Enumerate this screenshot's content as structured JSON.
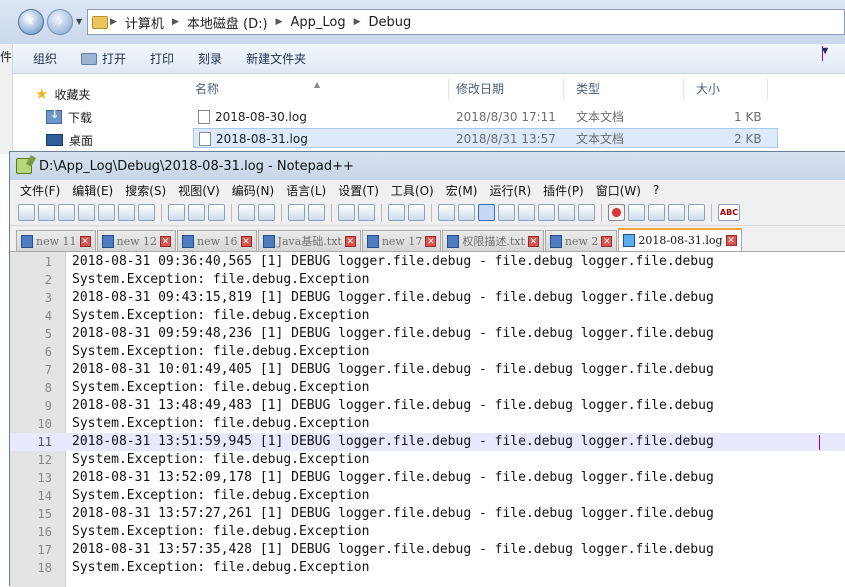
{
  "explorer": {
    "breadcrumb": [
      "计算机",
      "本地磁盘 (D:)",
      "App_Log",
      "Debug"
    ],
    "toolbar": {
      "organize": "组织",
      "open": "打开",
      "print": "打印",
      "burn": "刻录",
      "new_folder": "新建文件夹"
    },
    "left_edge_char": "件",
    "nav": {
      "favorites": "收藏夹",
      "downloads": "下载",
      "desktop": "桌面"
    },
    "columns": {
      "name": "名称",
      "date": "修改日期",
      "type": "类型",
      "size": "大小"
    },
    "files": [
      {
        "name": "2018-08-30.log",
        "date": "2018/8/30 17:11",
        "type": "文本文档",
        "size": "1 KB"
      },
      {
        "name": "2018-08-31.log",
        "date": "2018/8/31 13:57",
        "type": "文本文档",
        "size": "2 KB"
      }
    ]
  },
  "npp": {
    "title": "D:\\App_Log\\Debug\\2018-08-31.log - Notepad++",
    "menu": [
      "文件(F)",
      "编辑(E)",
      "搜索(S)",
      "视图(V)",
      "编码(N)",
      "语言(L)",
      "设置(T)",
      "工具(O)",
      "宏(M)",
      "运行(R)",
      "插件(P)",
      "窗口(W)",
      "?"
    ],
    "tabs": [
      {
        "label": "new 11",
        "active": false
      },
      {
        "label": "new 12",
        "active": false
      },
      {
        "label": "new 16",
        "active": false
      },
      {
        "label": "Java基础.txt",
        "active": false
      },
      {
        "label": "new 17",
        "active": false
      },
      {
        "label": "权限描述.txt",
        "active": false
      },
      {
        "label": "new 2",
        "active": false
      },
      {
        "label": "2018-08-31.log",
        "active": true
      }
    ],
    "current_line": 11,
    "lines": [
      {
        "n": "1",
        "text": "2018-08-31 09:36:40,565 [1] DEBUG logger.file.debug - file.debug logger.file.debug"
      },
      {
        "n": "2",
        "text": "System.Exception: file.debug.Exception"
      },
      {
        "n": "3",
        "text": "2018-08-31 09:43:15,819 [1] DEBUG logger.file.debug - file.debug logger.file.debug"
      },
      {
        "n": "4",
        "text": "System.Exception: file.debug.Exception"
      },
      {
        "n": "5",
        "text": "2018-08-31 09:59:48,236 [1] DEBUG logger.file.debug - file.debug logger.file.debug"
      },
      {
        "n": "6",
        "text": "System.Exception: file.debug.Exception"
      },
      {
        "n": "7",
        "text": "2018-08-31 10:01:49,405 [1] DEBUG logger.file.debug - file.debug logger.file.debug"
      },
      {
        "n": "8",
        "text": "System.Exception: file.debug.Exception"
      },
      {
        "n": "9",
        "text": "2018-08-31 13:48:49,483 [1] DEBUG logger.file.debug - file.debug logger.file.debug"
      },
      {
        "n": "10",
        "text": "System.Exception: file.debug.Exception"
      },
      {
        "n": "11",
        "text": "2018-08-31 13:51:59,945 [1] DEBUG logger.file.debug - file.debug logger.file.debug"
      },
      {
        "n": "12",
        "text": "System.Exception: file.debug.Exception"
      },
      {
        "n": "13",
        "text": "2018-08-31 13:52:09,178 [1] DEBUG logger.file.debug - file.debug logger.file.debug"
      },
      {
        "n": "14",
        "text": "System.Exception: file.debug.Exception"
      },
      {
        "n": "15",
        "text": "2018-08-31 13:57:27,261 [1] DEBUG logger.file.debug - file.debug logger.file.debug"
      },
      {
        "n": "16",
        "text": "System.Exception: file.debug.Exception"
      },
      {
        "n": "17",
        "text": "2018-08-31 13:57:35,428 [1] DEBUG logger.file.debug - file.debug logger.file.debug"
      },
      {
        "n": "18",
        "text": "System.Exception: file.debug.Exception"
      }
    ]
  }
}
